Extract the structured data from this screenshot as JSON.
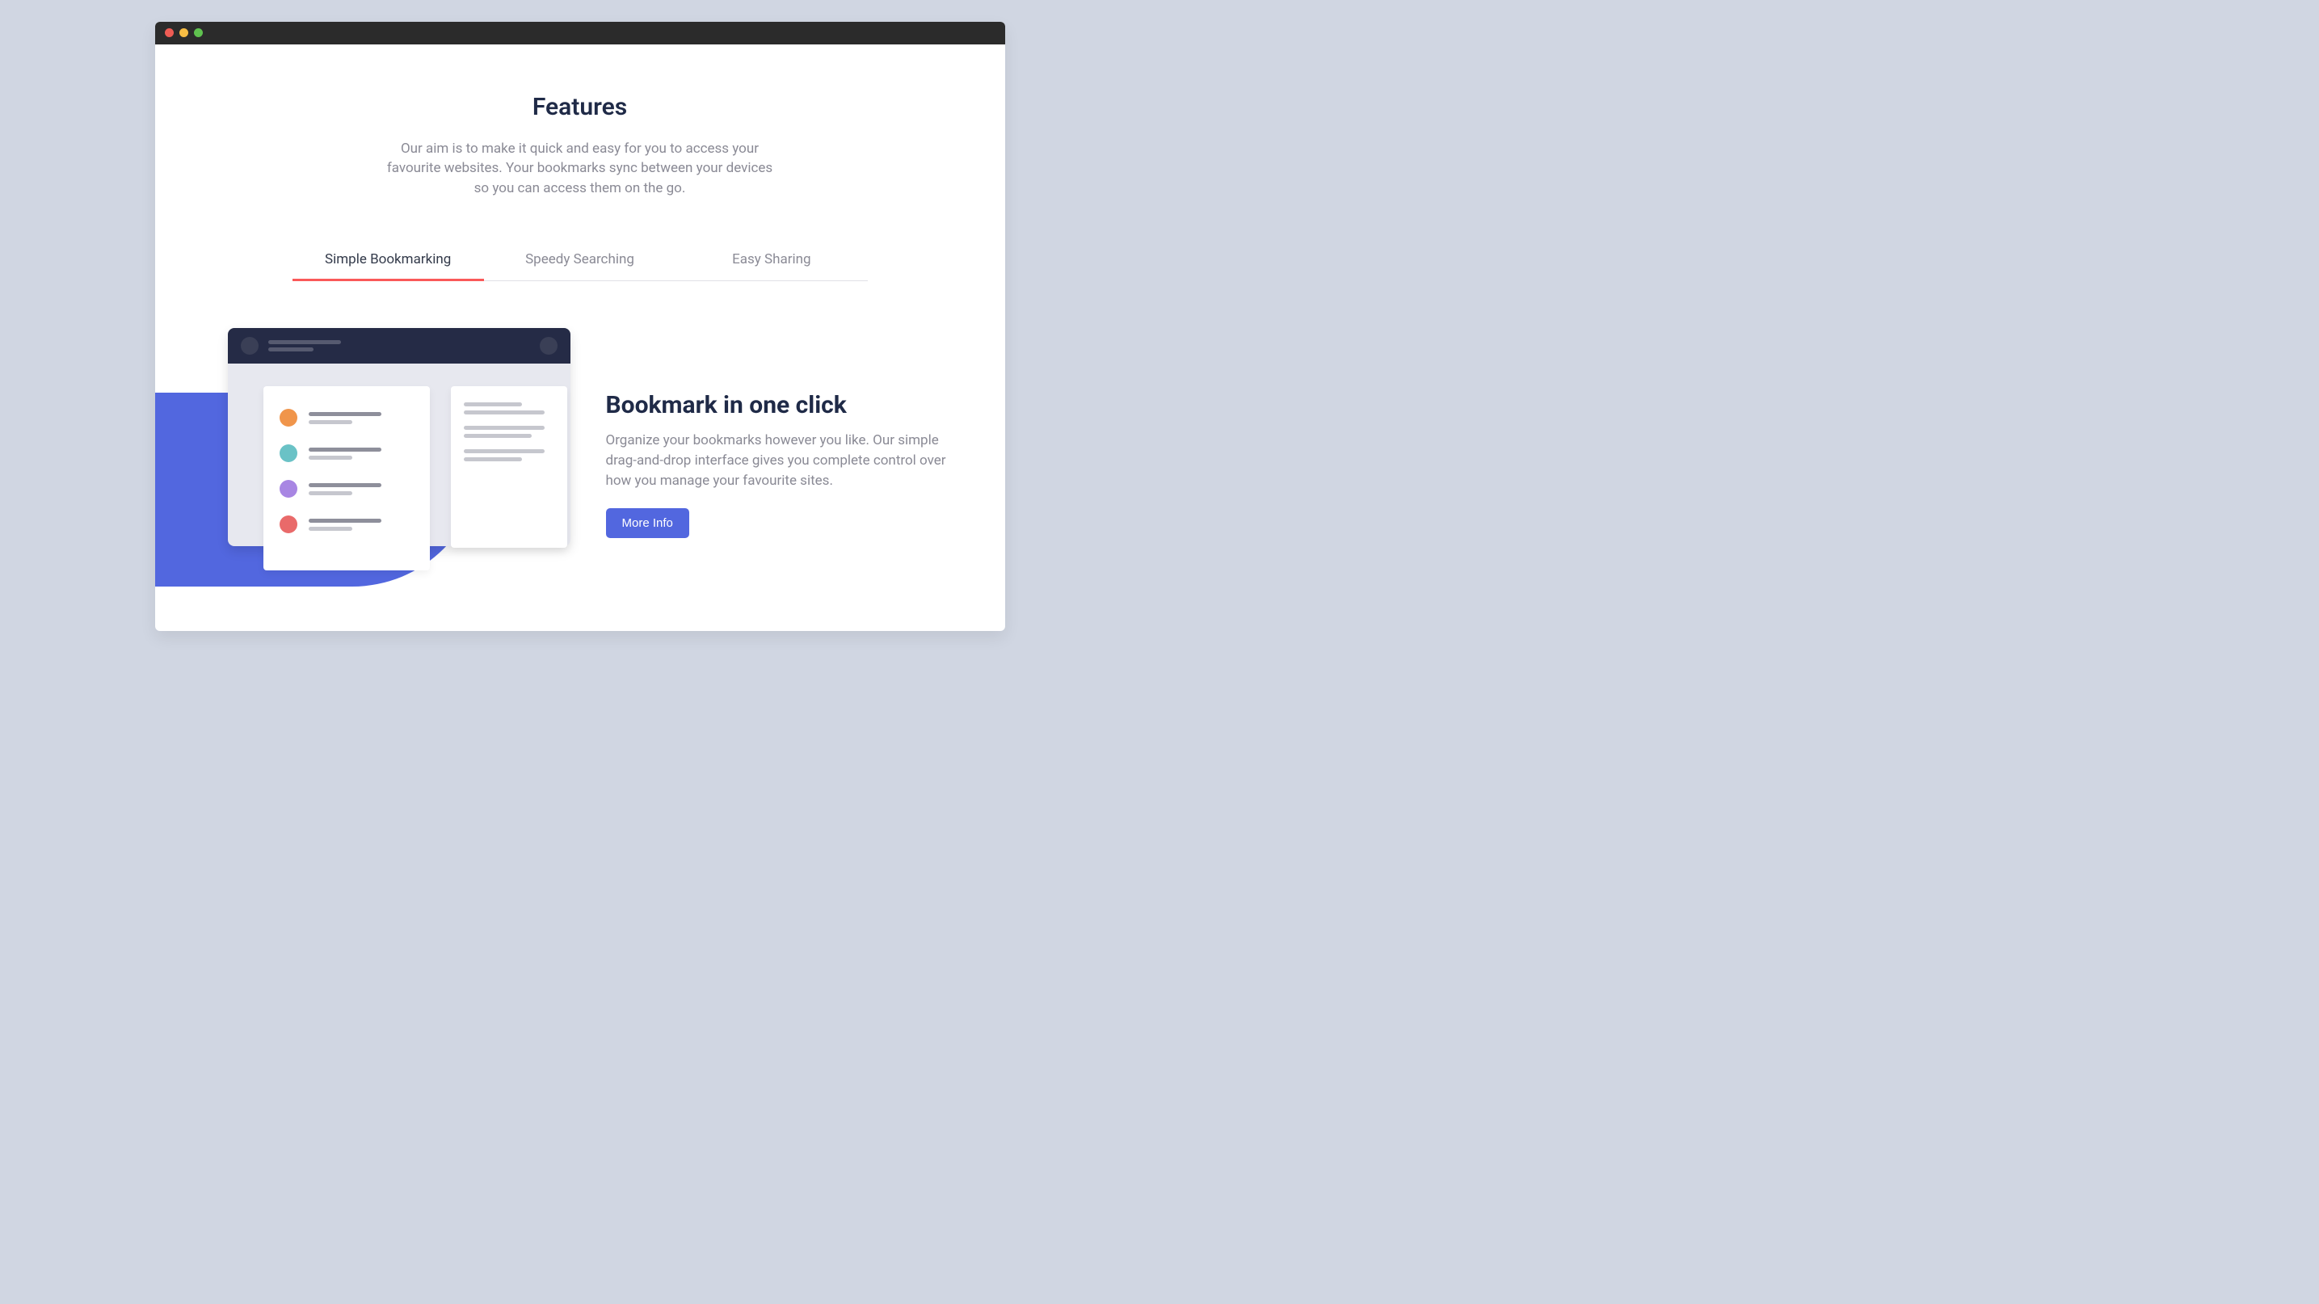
{
  "section": {
    "heading": "Features",
    "subheading": "Our aim is to make it quick and easy for you to access your favourite websites. Your bookmarks sync between your devices so you can access them on the go."
  },
  "tabs": {
    "items": [
      {
        "label": "Simple Bookmarking",
        "active": true
      },
      {
        "label": "Speedy Searching",
        "active": false
      },
      {
        "label": "Easy Sharing",
        "active": false
      }
    ]
  },
  "feature": {
    "title": "Bookmark in one click",
    "description": "Organize your bookmarks however you like. Our simple drag-and-drop interface gives you complete control over how you manage your favourite sites.",
    "button_label": "More Info"
  },
  "traffic_lights": [
    "red",
    "yellow",
    "green"
  ],
  "colors": {
    "accent": "#5267df",
    "tab_underline": "#fa5959",
    "heading": "#1f2a47",
    "muted_text": "#8a8a95"
  }
}
